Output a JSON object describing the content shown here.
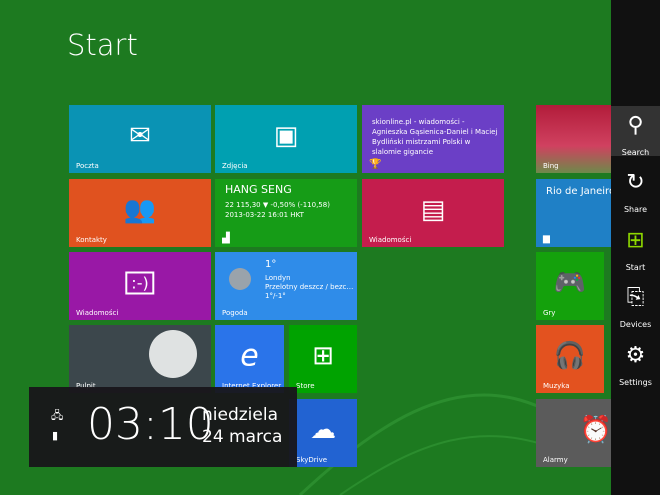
{
  "title": "Start",
  "tiles": {
    "mail": {
      "label": "Poczta",
      "color": "#0a93b4"
    },
    "photos": {
      "label": "Zdjęcia",
      "color": "#00a0b1"
    },
    "news_live": {
      "text": "skionline.pl - wiadomości - Agnieszka Gąsienica-Daniel i Maciej Bydliński mistrzami Polski w slalomie gigancie",
      "color": "#6b3fc6"
    },
    "people": {
      "label": "Kontakty",
      "color": "#e0521f"
    },
    "finance": {
      "title": "HANG SENG",
      "line1": "22 115,30  ▼ -0,50% (-110,58)",
      "line2": "2013-03-22 16:01 HKT",
      "color": "#169c17"
    },
    "news": {
      "label": "Wiadomości",
      "color": "#c41d4d"
    },
    "messaging": {
      "label": "Wiadomości",
      "color": "#9918a6"
    },
    "weather": {
      "label": "Pogoda",
      "temp": "1°",
      "city": "Londyn",
      "cond": "Przelotny deszcz / bezc…",
      "range": "1°/-1°",
      "color": "#2f8ce9"
    },
    "desktop": {
      "label": "Pulpit"
    },
    "ie": {
      "label": "Internet Explorer",
      "color": "#2a74ea"
    },
    "store": {
      "label": "Store",
      "color": "#00a300"
    },
    "skydrive": {
      "label": "SkyDrive",
      "color": "#2263d2"
    },
    "bing": {
      "label": "Bing"
    },
    "travel": {
      "label": "Rio de Janeiro",
      "color": "#1f80c6"
    },
    "games": {
      "label": "Gry",
      "color": "#14a10c"
    },
    "music": {
      "label": "Muzyka",
      "color": "#e3521f"
    },
    "alarms": {
      "label": "Alarmy",
      "color": "#5b5b5b"
    }
  },
  "charms": [
    {
      "label": "Search"
    },
    {
      "label": "Share"
    },
    {
      "label": "Start"
    },
    {
      "label": "Devices"
    },
    {
      "label": "Settings"
    }
  ],
  "clock": {
    "time": "03:10",
    "day": "niedziela",
    "date": "24 marca"
  }
}
